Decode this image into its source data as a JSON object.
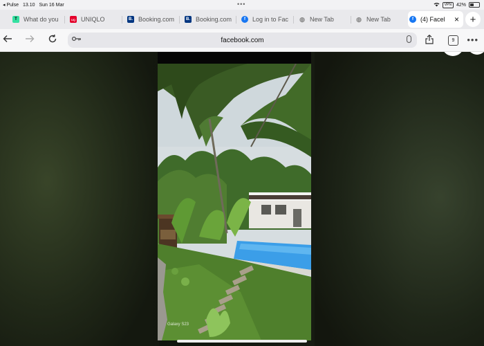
{
  "status_bar": {
    "carrier": "◂ Pulse",
    "time": "13.10",
    "date": "Sun 16 Mar",
    "vpn": "VPN",
    "battery": "42%"
  },
  "tabs": [
    {
      "label": "What do you",
      "favicon": "tripadvisor-icon",
      "color": "#34e0a1",
      "glyph": "T"
    },
    {
      "label": "UNIQLO",
      "favicon": "uniqlo-icon",
      "color": "#e4002b",
      "glyph": "UQ"
    },
    {
      "label": "Booking.com",
      "favicon": "booking-icon",
      "color": "#003580",
      "glyph": "B."
    },
    {
      "label": "Booking.com",
      "favicon": "booking-icon",
      "color": "#003580",
      "glyph": "B."
    },
    {
      "label": "Log in to Fac",
      "favicon": "facebook-icon",
      "color": "#1877f2",
      "glyph": "f"
    },
    {
      "label": "New Tab",
      "favicon": "globe-icon",
      "color": "#9a9a9a",
      "glyph": "◍"
    },
    {
      "label": "New Tab",
      "favicon": "globe-icon",
      "color": "#9a9a9a",
      "glyph": "◍"
    },
    {
      "label": "(4) Facel",
      "favicon": "facebook-icon",
      "color": "#1877f2",
      "glyph": "f",
      "active": true
    }
  ],
  "toolbar": {
    "url": "facebook.com",
    "tab_count": "9"
  },
  "content": {
    "watermark": "Galaxy S23"
  },
  "colors": {
    "pool": "#3b9ee8",
    "grass": "#4f7f2c",
    "sky": "#d6dde0",
    "active_tab": "#ffffff"
  }
}
